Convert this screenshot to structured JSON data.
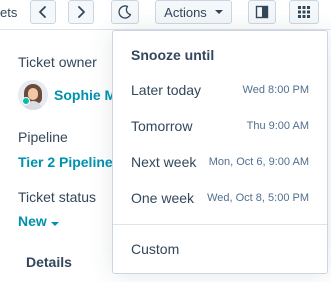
{
  "toolbar": {
    "left_text": "ets",
    "actions_label": "Actions"
  },
  "record": {
    "owner_label": "Ticket owner",
    "owner_name": "Sophie M",
    "pipeline_label": "Pipeline",
    "pipeline_value": "Tier 2 Pipeline",
    "status_label": "Ticket status",
    "status_value": "New",
    "tab_details": "Details"
  },
  "snooze_menu": {
    "title": "Snooze until",
    "items": [
      {
        "label": "Later today",
        "time": "Wed 8:00 PM"
      },
      {
        "label": "Tomorrow",
        "time": "Thu 9:00 AM"
      },
      {
        "label": "Next week",
        "time": "Mon, Oct 6, 9:00 AM"
      },
      {
        "label": "One week",
        "time": "Wed, Oct 8, 5:00 PM"
      }
    ],
    "custom_label": "Custom"
  },
  "colors": {
    "link": "#0091ae",
    "text": "#33475b",
    "presence": "#00bda5"
  }
}
